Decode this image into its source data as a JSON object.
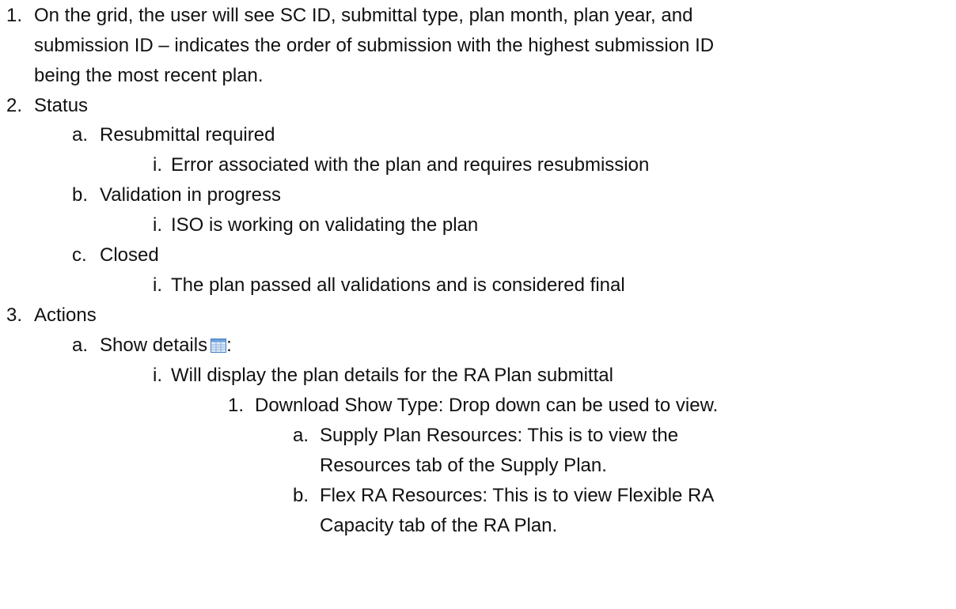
{
  "items": {
    "l1_num": "1.",
    "l1_text_a": "On the grid, the user will see SC ID, submittal type, plan month, plan year, and",
    "l1_text_b": "submission ID – indicates the order of submission with the highest submission ID",
    "l1_text_c": "being the most recent plan.",
    "l2_num": "2.",
    "l2_text": "Status",
    "l2a_num": "a.",
    "l2a_text": "Resubmittal required",
    "l2a_i_num": "i.",
    "l2a_i_text": "Error associated with the plan and requires resubmission",
    "l2b_num": "b.",
    "l2b_text": "Validation  in progress",
    "l2b_i_num": "i.",
    "l2b_i_text": "ISO is working on validating the plan",
    "l2c_num": "c.",
    "l2c_text": "Closed",
    "l2c_i_num": "i.",
    "l2c_i_text": "The plan passed all validations  and is considered final",
    "l3_num": "3.",
    "l3_text": "Actions",
    "l3a_num": "a.",
    "l3a_text": "Show details",
    "l3a_suffix": ":",
    "l3a_icon": "grid-details-icon",
    "l3a_i_num": "i.",
    "l3a_i_text": "Will display the plan details for the RA Plan submittal",
    "l3a_i_1_num": "1.",
    "l3a_i_1_text": "Download Show Type:  Drop down can be used to view.",
    "l3a_i_1_a_num": "a.",
    "l3a_i_1_a_text_a": "Supply Plan Resources:  This is to view the",
    "l3a_i_1_a_text_b": "Resources tab of the Supply Plan.",
    "l3a_i_1_b_num": "b.",
    "l3a_i_1_b_text_a": "Flex RA Resources:  This is to view Flexible RA",
    "l3a_i_1_b_text_b": "Capacity tab of the RA Plan."
  },
  "colors": {
    "text": "#111111",
    "icon_border": "#4a7fc0",
    "icon_header": "#6aa0dc",
    "icon_cell": "#dce9f7"
  }
}
